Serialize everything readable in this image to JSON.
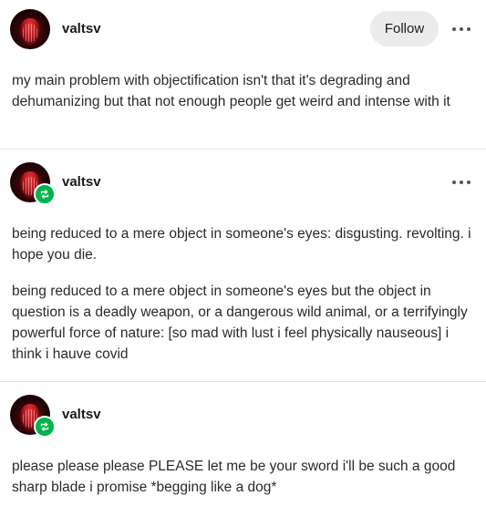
{
  "posts": [
    {
      "username": "valtsv",
      "follow_label": "Follow",
      "paragraphs": [
        "my main problem with objectification isn't that it's degrading and dehumanizing but that not enough people get weird and intense with it"
      ]
    },
    {
      "username": "valtsv",
      "paragraphs": [
        "being reduced to a mere object in someone's eyes: disgusting. revolting. i hope you die.",
        "being reduced to a mere object in someone's eyes but the object in question is a deadly weapon, or a dangerous wild animal, or a terrifyingly powerful force of nature: [so mad with lust i feel physically nauseous] i think i hauve covid"
      ]
    },
    {
      "username": "valtsv",
      "paragraphs": [
        "please please please PLEASE let me be your sword i'll be such a good sharp blade i promise *begging like a dog*"
      ]
    }
  ],
  "icons": {
    "more": "more-options-icon",
    "reblog": "reblog-icon",
    "avatar": "avatar"
  },
  "colors": {
    "reblog_badge": "#00b34a",
    "follow_bg": "#ebebeb",
    "divider": "#e2e2e2"
  }
}
